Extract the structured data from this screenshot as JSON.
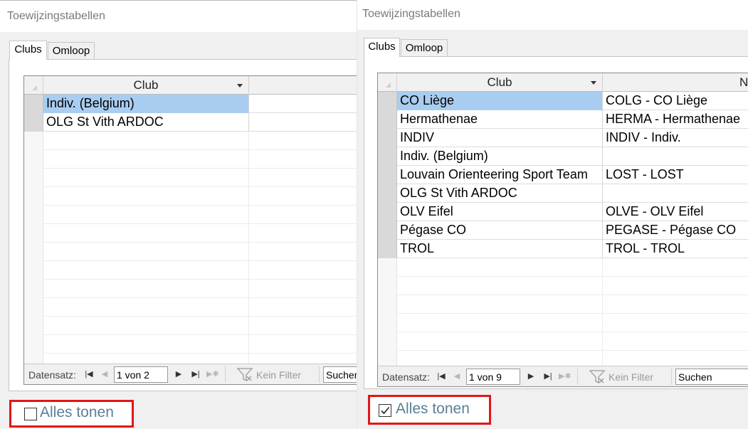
{
  "panels": [
    {
      "window_title": "Toewijzingstabellen",
      "tabs": [
        {
          "label": "Clubs",
          "active": true
        },
        {
          "label": "Omloop",
          "active": false
        }
      ],
      "grid": {
        "column_club": "Club",
        "column_n": "",
        "rows": [
          {
            "club": "Indiv. (Belgium)",
            "n": ""
          },
          {
            "club": "OLG St Vith ARDOC",
            "n": ""
          }
        ],
        "selected_row": 0
      },
      "navigator": {
        "label": "Datensatz:",
        "position": "1 von 2",
        "filter": "Kein Filter",
        "search": "Suchen"
      },
      "show_all": {
        "label": "Alles tonen",
        "checked": false
      }
    },
    {
      "window_title": "Toewijzingstabellen",
      "tabs": [
        {
          "label": "Clubs",
          "active": true
        },
        {
          "label": "Omloop",
          "active": false
        }
      ],
      "grid": {
        "column_club": "Club",
        "column_n": "N",
        "rows": [
          {
            "club": "CO Liège",
            "n": "COLG - CO Liège"
          },
          {
            "club": "Hermathenae",
            "n": "HERMA - Hermathenae"
          },
          {
            "club": "INDIV",
            "n": "INDIV - Indiv."
          },
          {
            "club": "Indiv. (Belgium)",
            "n": ""
          },
          {
            "club": "Louvain Orienteering Sport Team",
            "n": "LOST - LOST"
          },
          {
            "club": "OLG St Vith ARDOC",
            "n": ""
          },
          {
            "club": "OLV Eifel",
            "n": "OLVE - OLV Eifel"
          },
          {
            "club": "Pégase CO",
            "n": "PEGASE - Pégase CO"
          },
          {
            "club": "TROL",
            "n": "TROL - TROL"
          }
        ],
        "selected_row": 0
      },
      "navigator": {
        "label": "Datensatz:",
        "position": "1 von 9",
        "filter": "Kein Filter",
        "search": "Suchen"
      },
      "show_all": {
        "label": "Alles tonen",
        "checked": true
      }
    }
  ],
  "colors": {
    "highlight": "#a9cdf0",
    "annotation_border": "#e21616",
    "checkbox_label": "#5a7f98"
  },
  "icons": {
    "first": "first-record-icon",
    "prev": "previous-record-icon",
    "next": "next-record-icon",
    "last": "last-record-icon",
    "new": "new-record-icon",
    "filter": "filter-icon",
    "check": "checkmark-icon"
  }
}
